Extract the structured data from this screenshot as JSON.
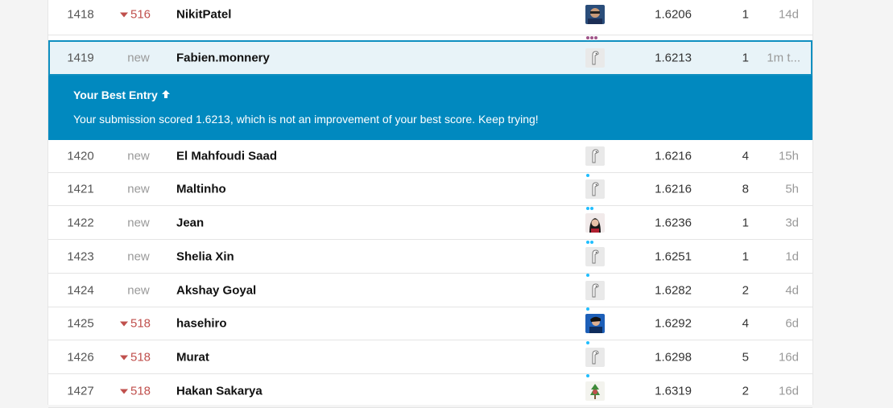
{
  "colors": {
    "accent": "#0189bf",
    "highlight_bg": "#e8f3f8",
    "rank_down": "#c0504d",
    "muted": "#999999"
  },
  "banner": {
    "title": "Your Best Entry",
    "arrow": "↑",
    "message": "Your submission scored 1.6213, which is not an improvement of your best score. Keep trying!"
  },
  "rows": [
    {
      "rank": "1418",
      "change": "516",
      "name": "NikitPatel",
      "avatar": "photo-avatar",
      "score": "1.6206",
      "entries": "1",
      "last": "14d"
    },
    {
      "rank": "1419",
      "change": "new",
      "name": "Fabien.monnery",
      "avatar": "goose-avatar",
      "score": "1.6213",
      "entries": "1",
      "last": "1m t..."
    },
    {
      "rank": "1420",
      "change": "new",
      "name": "El Mahfoudi Saad",
      "avatar": "goose-avatar",
      "score": "1.6216",
      "entries": "4",
      "last": "15h"
    },
    {
      "rank": "1421",
      "change": "new",
      "name": "Maltinho",
      "avatar": "goose-avatar",
      "score": "1.6216",
      "entries": "8",
      "last": "5h"
    },
    {
      "rank": "1422",
      "change": "new",
      "name": "Jean",
      "avatar": "photo-avatar",
      "score": "1.6236",
      "entries": "1",
      "last": "3d"
    },
    {
      "rank": "1423",
      "change": "new",
      "name": "Shelia Xin",
      "avatar": "goose-avatar",
      "score": "1.6251",
      "entries": "1",
      "last": "1d"
    },
    {
      "rank": "1424",
      "change": "new",
      "name": "Akshay Goyal",
      "avatar": "goose-avatar",
      "score": "1.6282",
      "entries": "2",
      "last": "4d"
    },
    {
      "rank": "1425",
      "change": "518",
      "name": "hasehiro",
      "avatar": "photo-avatar",
      "score": "1.6292",
      "entries": "4",
      "last": "6d"
    },
    {
      "rank": "1426",
      "change": "518",
      "name": "Murat",
      "avatar": "goose-avatar",
      "score": "1.6298",
      "entries": "5",
      "last": "16d"
    },
    {
      "rank": "1427",
      "change": "518",
      "name": "Hakan Sakarya",
      "avatar": "photo-avatar",
      "score": "1.6319",
      "entries": "2",
      "last": "16d"
    }
  ]
}
